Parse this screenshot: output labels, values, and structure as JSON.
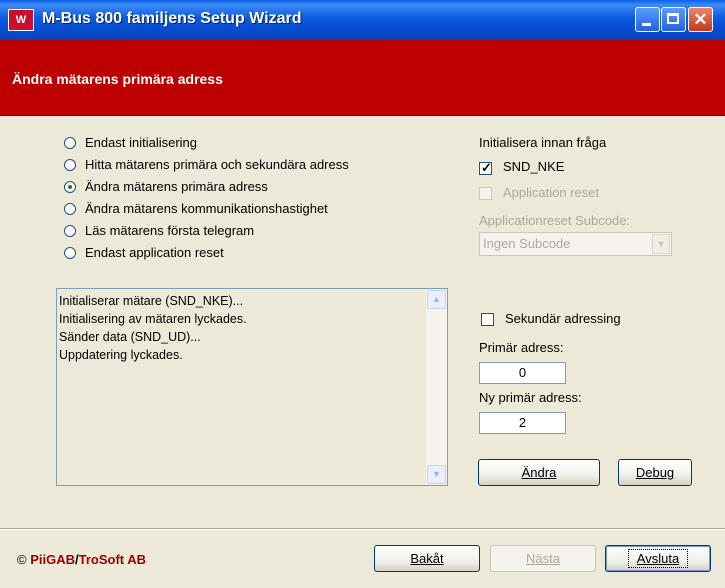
{
  "window": {
    "title": "M-Bus 800 familjens Setup Wizard",
    "icon_text": "W"
  },
  "header": {
    "title": "Ändra mätarens primära adress"
  },
  "operations": [
    {
      "label": "Endast initialisering",
      "checked": false
    },
    {
      "label": "Hitta mätarens primära och sekundära adress",
      "checked": false
    },
    {
      "label": "Ändra mätarens primära adress",
      "checked": true
    },
    {
      "label": "Ändra mätarens kommunikationshastighet",
      "checked": false
    },
    {
      "label": "Läs mätarens första telegram",
      "checked": false
    },
    {
      "label": "Endast application reset",
      "checked": false
    }
  ],
  "log": {
    "lines": [
      "Initialiserar mätare (SND_NKE)...",
      "Initialisering av mätaren lyckades.",
      "Sänder data (SND_UD)...",
      "Uppdatering lyckades."
    ]
  },
  "init": {
    "heading": "Initialisera innan fråga",
    "snd_nke_label": "SND_NKE",
    "snd_nke_checked": true,
    "app_reset_label": "Application reset",
    "app_reset_checked": false,
    "subcode_label": "Applicationreset Subcode:",
    "subcode_value": "Ingen Subcode"
  },
  "addressing": {
    "secondary_label": "Sekundär adressing",
    "secondary_checked": false,
    "primary_label": "Primär adress:",
    "primary_value": "0",
    "new_primary_label": "Ny primär adress:",
    "new_primary_value": "2"
  },
  "buttons": {
    "change": "Ändra",
    "debug": "Debug",
    "back": "Bakåt",
    "next": "Nästa",
    "finish": "Avsluta"
  },
  "brand": {
    "copyright": "©",
    "company1": "PiiGAB",
    "separator": "/",
    "company2": "TroSoft AB"
  },
  "colors": {
    "header_bg": "#BC0000",
    "titlebar": "#0548C8",
    "brand_text": "#9E0000"
  }
}
